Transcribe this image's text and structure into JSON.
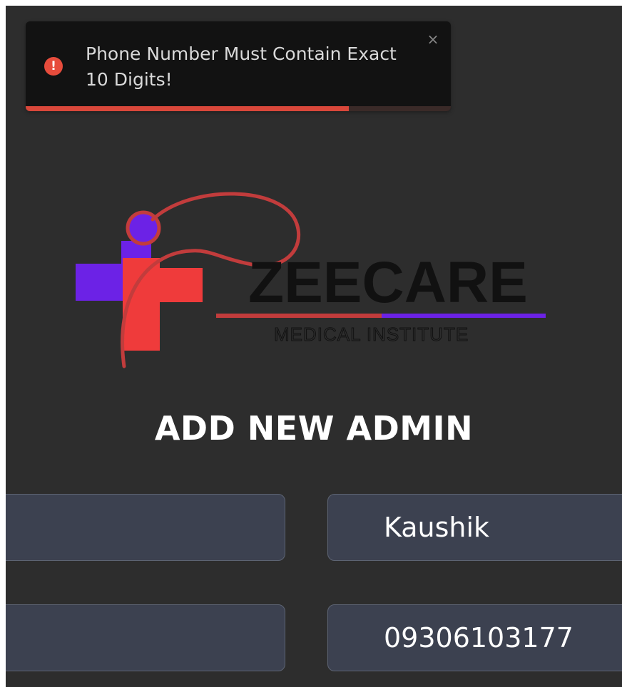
{
  "toast": {
    "message": "Phone Number Must Contain Exact 10 Digits!",
    "icon": "error-icon",
    "close_icon": "close-icon",
    "progress_fraction": 0.76,
    "colors": {
      "background": "#121212",
      "error": "#e74c3c",
      "progress": "#d9473a"
    }
  },
  "logo": {
    "brand_name": "ZEECARE",
    "tagline": "MEDICAL INSTITUTE",
    "colors": {
      "red": "#ef3b3b",
      "purple": "#6c22e6"
    }
  },
  "form": {
    "title": "ADD NEW ADMIN",
    "first_name": "",
    "last_name": "Kaushik",
    "email": "",
    "phone": "09306103177"
  },
  "colors": {
    "panel_background": "#2d2d2d",
    "input_background": "#3c4150",
    "input_border": "#5d6473"
  }
}
